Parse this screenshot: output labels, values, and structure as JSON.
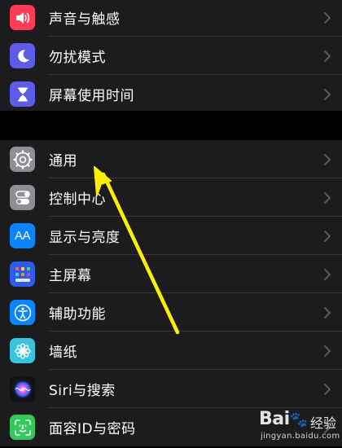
{
  "settings_top": [
    {
      "label": "声音与触感",
      "icon": "speaker-icon",
      "color": "#ff3b55"
    },
    {
      "label": "勿扰模式",
      "icon": "moon-icon",
      "color": "#5e5ce6"
    },
    {
      "label": "屏幕使用时间",
      "icon": "hourglass-icon",
      "color": "#5e5ce6"
    }
  ],
  "settings_main": [
    {
      "label": "通用",
      "icon": "gear-icon",
      "color": "#8e8e93"
    },
    {
      "label": "控制中心",
      "icon": "toggles-icon",
      "color": "#8e8e93"
    },
    {
      "label": "显示与亮度",
      "icon": "text-size-icon",
      "color": "#0a84ff"
    },
    {
      "label": "主屏幕",
      "icon": "home-grid-icon",
      "color": "#2f5bea"
    },
    {
      "label": "辅助功能",
      "icon": "accessibility-icon",
      "color": "#0a84ff"
    },
    {
      "label": "墙纸",
      "icon": "flower-icon",
      "color": "#3ac3dd"
    },
    {
      "label": "Siri与搜索",
      "icon": "siri-icon",
      "color": "#1c1c1e"
    },
    {
      "label": "面容ID与密码",
      "icon": "face-id-icon",
      "color": "#32c95a"
    }
  ],
  "display_icon_text": "AA",
  "annotation": {
    "arrow_color": "#ffee00"
  },
  "watermark": {
    "logo": "Bai",
    "logo_end": "百",
    "brand": "经验",
    "url": "jingyan.baidu.com"
  }
}
